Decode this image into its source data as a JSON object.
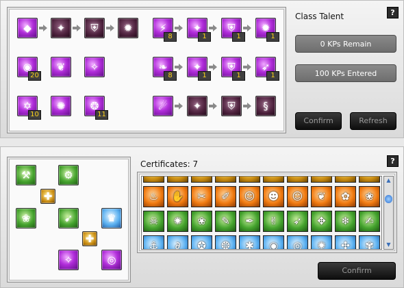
{
  "talent": {
    "title": "Class Talent",
    "help": "?",
    "kps_remain": "0 KPs Remain",
    "kps_entered": "100 KPs Entered",
    "confirm_label": "Confirm",
    "refresh_label": "Refresh",
    "left_tree": [
      {
        "name": "talent-crystal-icon",
        "color": "purple",
        "sym": "◆",
        "level": ""
      },
      {
        "name": "talent-figure-icon",
        "color": "dark",
        "sym": "✦",
        "level": ""
      },
      {
        "name": "talent-shield-icon",
        "color": "dark",
        "sym": "⛨",
        "level": ""
      },
      {
        "name": "talent-swirl-icon",
        "color": "dark",
        "sym": "✹",
        "level": ""
      },
      {
        "name": "talent-orb-icon",
        "color": "purple",
        "sym": "◉",
        "level": "20"
      },
      {
        "name": "talent-creature-icon",
        "color": "purple",
        "sym": "❦",
        "level": ""
      },
      {
        "name": "talent-wisp-icon",
        "color": "purple",
        "sym": "✧",
        "level": ""
      },
      {
        "name": "talent-hexagram-icon",
        "color": "purple",
        "sym": "✡",
        "level": "10"
      },
      {
        "name": "talent-burst-icon",
        "color": "purple",
        "sym": "✺",
        "level": ""
      },
      {
        "name": "talent-ring-icon",
        "color": "purple",
        "sym": "❂",
        "level": "11"
      }
    ],
    "right_tree": [
      {
        "name": "talent-lightning-icon",
        "color": "purple",
        "sym": "⚡",
        "level": "8"
      },
      {
        "name": "talent-caster-icon",
        "color": "purple",
        "sym": "✦",
        "level": "1"
      },
      {
        "name": "talent-ward-icon",
        "color": "purple",
        "sym": "⛨",
        "level": "1"
      },
      {
        "name": "talent-vortex-icon",
        "color": "purple",
        "sym": "✹",
        "level": "1"
      },
      {
        "name": "talent-dragon-icon",
        "color": "purple",
        "sym": "❧",
        "level": "8"
      },
      {
        "name": "talent-summon-icon",
        "color": "purple",
        "sym": "✦",
        "level": "1"
      },
      {
        "name": "talent-aegis-icon",
        "color": "purple",
        "sym": "⛨",
        "level": "1"
      },
      {
        "name": "talent-wing-icon",
        "color": "purple",
        "sym": "➶",
        "level": "1"
      },
      {
        "name": "talent-flame-icon",
        "color": "purple",
        "sym": "☄",
        "level": ""
      },
      {
        "name": "talent-rune-icon",
        "color": "dark",
        "sym": "✦",
        "level": ""
      },
      {
        "name": "talent-guard-icon",
        "color": "dark",
        "sym": "⛨",
        "level": ""
      },
      {
        "name": "talent-serpent-icon",
        "color": "dark",
        "sym": "§",
        "level": ""
      }
    ]
  },
  "certificates": {
    "title": "Certificates: 7",
    "help": "?",
    "confirm_label": "Confirm",
    "skill_icons": [
      {
        "name": "shovel-icon",
        "color": "green",
        "sym": "⚒"
      },
      {
        "name": "gear-ring-icon",
        "color": "green",
        "sym": "⚙"
      },
      {
        "name": "gold-connector-icon",
        "color": "gold",
        "sym": "✚"
      },
      {
        "name": "hand-leaf-icon",
        "color": "green",
        "sym": "❀"
      },
      {
        "name": "bow-icon",
        "color": "green",
        "sym": "➹"
      },
      {
        "name": "crown-icon",
        "color": "blue",
        "sym": "♛"
      },
      {
        "name": "gold-connector-icon",
        "color": "gold",
        "sym": "✚"
      },
      {
        "name": "sparkle-arrow-icon",
        "color": "purple",
        "sym": "✧"
      },
      {
        "name": "spiral-icon",
        "color": "purple",
        "sym": "◎"
      }
    ],
    "grid_rows": [
      {
        "color": "gold",
        "syms": [
          "✿",
          "✿",
          "✿",
          "✿",
          "✿",
          "✿",
          "✿",
          "✿",
          "✿",
          "✿"
        ]
      },
      {
        "color": "orange",
        "syms": [
          "♨",
          "✋",
          "✂",
          "✐",
          "☺",
          "☻",
          "☺",
          "❦",
          "✿",
          "❀"
        ]
      },
      {
        "color": "green",
        "syms": [
          "☠",
          "✺",
          "❀",
          "✎",
          "✒",
          "✌",
          "➶",
          "✥",
          "❄",
          "✍"
        ]
      },
      {
        "color": "blue",
        "syms": [
          "⚓",
          "∂",
          "✪",
          "❂",
          "✱",
          "◉",
          "◎",
          "✺",
          "✣",
          "✾"
        ]
      }
    ],
    "scroll_up": "▲",
    "scroll_down": "▼"
  }
}
